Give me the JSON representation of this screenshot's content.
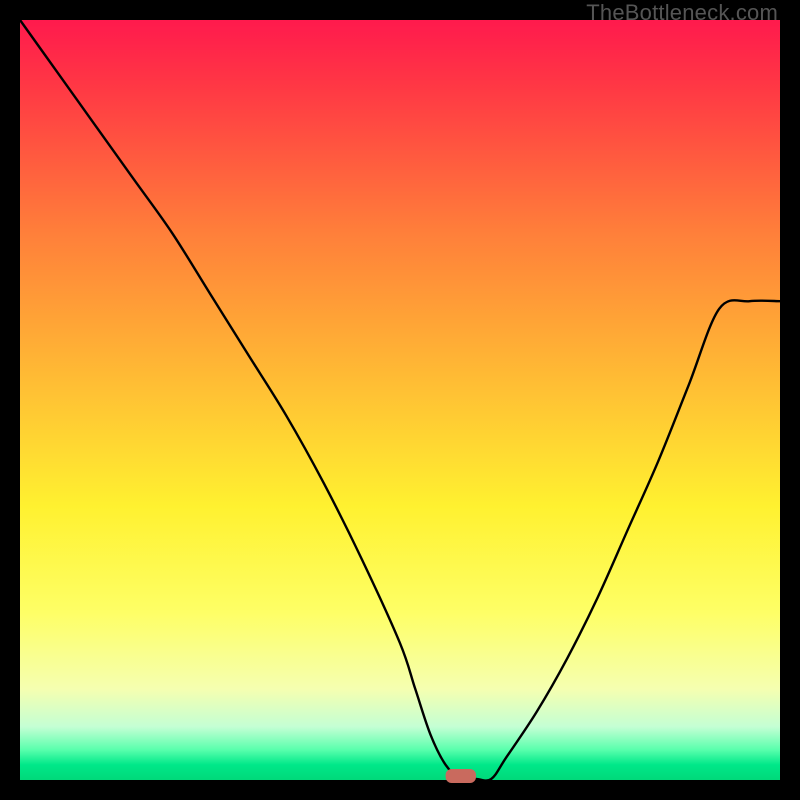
{
  "watermark": "TheBottleneck.com",
  "colors": {
    "frame": "#000000",
    "gradient_top": "#ff1a4d",
    "gradient_bottom": "#00d97a",
    "curve": "#000000",
    "marker": "#c96a5e"
  },
  "chart_data": {
    "type": "line",
    "title": "",
    "xlabel": "",
    "ylabel": "",
    "xlim": [
      0,
      100
    ],
    "ylim": [
      0,
      100
    ],
    "grid": false,
    "legend": false,
    "x": [
      0,
      5,
      10,
      15,
      20,
      25,
      30,
      35,
      40,
      45,
      50,
      52,
      54,
      56,
      58,
      60,
      62,
      64,
      68,
      72,
      76,
      80,
      84,
      88,
      92,
      96,
      100
    ],
    "values": [
      100,
      93,
      86,
      79,
      72,
      64,
      56,
      48,
      39,
      29,
      18,
      12,
      6,
      2,
      0,
      0,
      0,
      3,
      9,
      16,
      24,
      33,
      42,
      52,
      62,
      63,
      63
    ],
    "marker": {
      "x": 58,
      "y": 0,
      "width": 4,
      "height": 2
    },
    "annotations": []
  }
}
